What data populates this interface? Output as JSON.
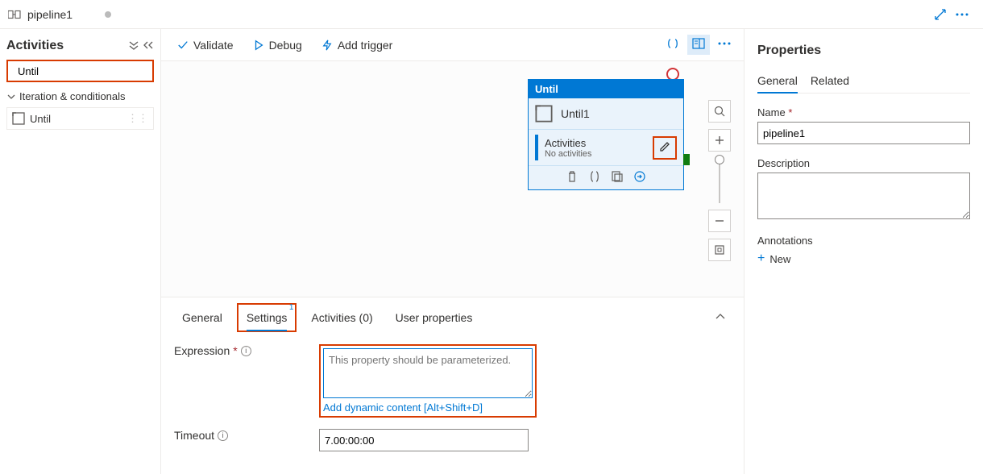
{
  "topbar": {
    "title": "pipeline1"
  },
  "sidebar": {
    "heading": "Activities",
    "search_value": "Until",
    "group": "Iteration & conditionals",
    "item": "Until"
  },
  "toolbar": {
    "validate": "Validate",
    "debug": "Debug",
    "add_trigger": "Add trigger"
  },
  "node": {
    "type": "Until",
    "name": "Until1",
    "sub_heading": "Activities",
    "sub_text": "No activities"
  },
  "bottom": {
    "tabs": {
      "general": "General",
      "settings": "Settings",
      "activities": "Activities (0)",
      "user_props": "User properties"
    },
    "settings_badge": "1",
    "expression_label": "Expression",
    "expression_placeholder": "This property should be parameterized.",
    "dynamic_link": "Add dynamic content [Alt+Shift+D]",
    "timeout_label": "Timeout",
    "timeout_value": "7.00:00:00"
  },
  "props": {
    "heading": "Properties",
    "tabs": {
      "general": "General",
      "related": "Related"
    },
    "name_label": "Name",
    "name_value": "pipeline1",
    "desc_label": "Description",
    "ann_label": "Annotations",
    "new": "New"
  }
}
